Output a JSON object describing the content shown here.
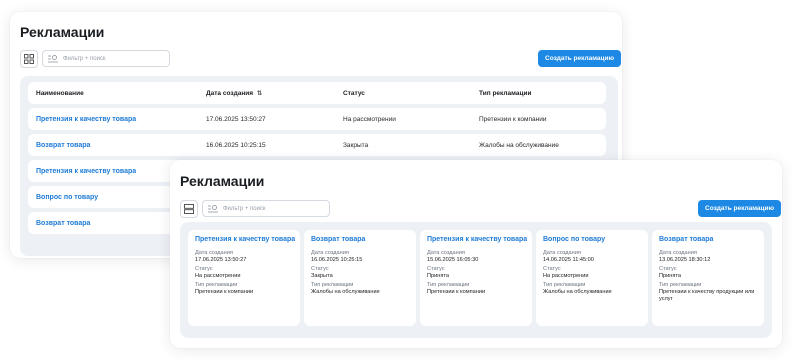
{
  "list_view": {
    "title": "Рекламации",
    "filter_placeholder": "Фильтр + поиск",
    "create_button": "Создать рекламацию",
    "columns": [
      "Наименование",
      "Дата создания",
      "Статус",
      "Тип рекламации"
    ],
    "rows": [
      {
        "name": "Претензия к качеству товара",
        "date": "17.06.2025 13:50:27",
        "status": "На рассмотрении",
        "type": "Претензии к компании"
      },
      {
        "name": "Возврат товара",
        "date": "16.06.2025 10:25:15",
        "status": "Закрыта",
        "type": "Жалобы на обслуживание"
      },
      {
        "name": "Претензия к качеству товара"
      },
      {
        "name": "Вопрос по товару"
      },
      {
        "name": "Возврат товара"
      }
    ]
  },
  "card_view": {
    "title": "Рекламации",
    "filter_placeholder": "Фильтр + поиск",
    "create_button": "Создать рекламацию",
    "field_labels": {
      "date": "Дата создания",
      "status": "Статус",
      "type": "Тип рекламации"
    },
    "cards": [
      {
        "title": "Претензия к качеству товара",
        "date": "17.06.2025 13:50:27",
        "status": "На рассмотрении",
        "type": "Претензии к компании"
      },
      {
        "title": "Возврат товара",
        "date": "16.06.2025 10:25:15",
        "status": "Закрыта",
        "type": "Жалобы на обслуживание"
      },
      {
        "title": "Претензия к качеству товара",
        "date": "15.06.2025 16:05:30",
        "status": "Принята",
        "type": "Претензии к компании"
      },
      {
        "title": "Вопрос по товару",
        "date": "14.06.2025 11:45:00",
        "status": "На рассмотрении",
        "type": "Жалобы на обслуживание"
      },
      {
        "title": "Возврат товара",
        "date": "13.06.2025 18:30:12",
        "status": "Принята",
        "type": "Претензии к качеству продукции или услуг"
      }
    ]
  },
  "icons": {
    "grid_view": "grid-icon",
    "list_view": "rows-icon",
    "filter": "filter-icon",
    "sort": "sort-icon"
  },
  "colors": {
    "accent": "#1e88e5",
    "link": "#1e7bd6",
    "table_bg": "#edf0f5"
  }
}
